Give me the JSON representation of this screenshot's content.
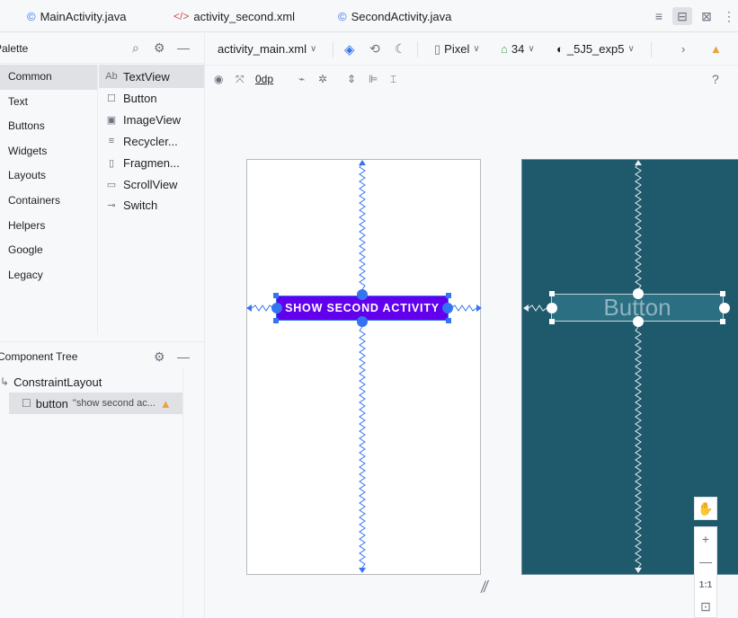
{
  "tabs": [
    {
      "icon": "©",
      "label": "MainActivity.java"
    },
    {
      "icon": "</>",
      "label": "activity_second.xml"
    },
    {
      "icon": "©",
      "label": "SecondActivity.java"
    }
  ],
  "palette": {
    "title": "Palette",
    "categories": [
      "Common",
      "Text",
      "Buttons",
      "Widgets",
      "Layouts",
      "Containers",
      "Helpers",
      "Google",
      "Legacy"
    ],
    "selected_category": "Common",
    "items": [
      {
        "icon": "Ab",
        "label": "TextView"
      },
      {
        "icon": "☐",
        "label": "Button"
      },
      {
        "icon": "▣",
        "label": "ImageView"
      },
      {
        "icon": "≡",
        "label": "Recycler..."
      },
      {
        "icon": "▯",
        "label": "Fragmen..."
      },
      {
        "icon": "▭",
        "label": "ScrollView"
      },
      {
        "icon": "⊸",
        "label": "Switch"
      }
    ]
  },
  "component_tree": {
    "title": "Component Tree",
    "root": "ConstraintLayout",
    "child_name": "button",
    "child_desc": "\"show second ac..."
  },
  "editor_toolbar": {
    "file": "activity_main.xml",
    "device": "Pixel",
    "api": "34",
    "theme": "_5J5_exp5",
    "margin": "0dp",
    "help": "?"
  },
  "design": {
    "button_label": "SHOW SECOND ACTIVITY",
    "blueprint_button_label": "Button"
  },
  "zoom": {
    "one_to_one": "1:1"
  },
  "colors": {
    "accent": "#3574f0",
    "button": "#6200ee",
    "blueprint": "#1f5a6c",
    "warning": "#e8a33e"
  }
}
